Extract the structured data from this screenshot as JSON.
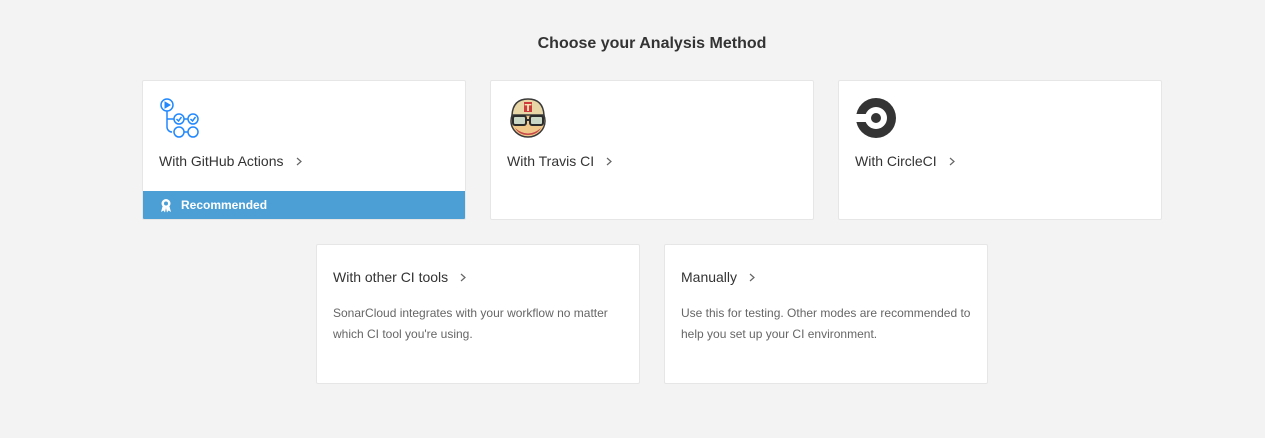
{
  "page": {
    "title": "Choose your Analysis Method"
  },
  "cards": {
    "github": {
      "label": "With GitHub Actions",
      "badge": "Recommended",
      "icon": "github-actions-icon"
    },
    "travis": {
      "label": "With Travis CI",
      "icon": "travis-ci-icon"
    },
    "circle": {
      "label": "With CircleCI",
      "icon": "circleci-icon"
    },
    "other": {
      "label": "With other CI tools",
      "description": "SonarCloud integrates with your workflow no matter which CI tool you're using."
    },
    "manual": {
      "label": "Manually",
      "description": "Use this for testing. Other modes are recommended to help you set up your CI environment."
    }
  },
  "colors": {
    "accent": "#4b9fd5",
    "background": "#f3f3f3",
    "card": "#ffffff",
    "github_icon": "#2188ff"
  }
}
